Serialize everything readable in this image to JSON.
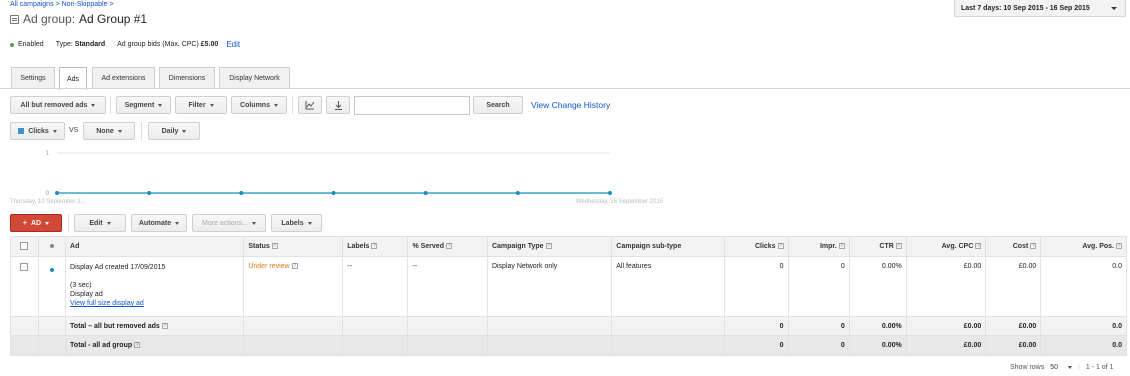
{
  "breadcrumb": {
    "root": "All campaigns",
    "sep": ">",
    "campaign": "Non-Skippable",
    "trail": ">"
  },
  "title": {
    "prefix": "Ad group:",
    "name": "Ad Group #1"
  },
  "date_range": "Last 7 days: 10 Sep 2015 - 16 Sep 2015",
  "status": {
    "state": "Enabled",
    "type_label": "Type:",
    "type_value": "Standard",
    "bids_label": "Ad group bids (Max. CPC)",
    "bids_value": "£5.00",
    "edit": "Edit"
  },
  "tabs": [
    "Settings",
    "Ads",
    "Ad extensions",
    "Dimensions",
    "Display Network"
  ],
  "active_tab": "Ads",
  "toolbar": {
    "filter_view": "All but removed ads",
    "segment": "Segment",
    "filter": "Filter",
    "columns": "Columns",
    "chart_icon": "line-chart-icon",
    "download_icon": "download-icon",
    "search_value": "",
    "search_button": "Search",
    "history_link": "View Change History"
  },
  "chart_controls": {
    "metric1": "Clicks",
    "vs": "VS",
    "metric2": "None",
    "period": "Daily"
  },
  "chart_data": {
    "type": "line",
    "x": [
      "Thursday, 10 September 2...",
      "",
      "",
      "",
      "",
      "",
      "Wednesday, 16 September 2015"
    ],
    "series": [
      {
        "values": [
          0,
          0,
          0,
          0,
          0,
          0,
          0
        ],
        "color": "#1a8fc4"
      }
    ],
    "yticks": [
      "1",
      "0"
    ],
    "ylim": [
      0,
      1
    ],
    "grid": true
  },
  "actions": {
    "add": "AD",
    "edit": "Edit",
    "automate": "Automate",
    "more": "More actions...",
    "labels": "Labels"
  },
  "table": {
    "headers": {
      "ad": "Ad",
      "status": "Status",
      "labels": "Labels",
      "served": "% Served",
      "campaign_type": "Campaign Type",
      "campaign_subtype": "Campaign sub-type",
      "clicks": "Clicks",
      "impr": "Impr.",
      "ctr": "CTR",
      "avg_cpc": "Avg. CPC",
      "cost": "Cost",
      "avg_pos": "Avg. Pos."
    },
    "row": {
      "ad_title": "Display Ad created 17/09/2015",
      "ad_duration": "(3 sec)",
      "ad_kind": "Display ad",
      "ad_link": "View full size display ad",
      "status": "Under review",
      "labels": "--",
      "served": "--",
      "campaign_type": "Display Network only",
      "campaign_subtype": "All features",
      "clicks": "0",
      "impr": "0",
      "ctr": "0.00%",
      "avg_cpc": "£0.00",
      "cost": "£0.00",
      "avg_pos": "0.0"
    },
    "total_but_removed": {
      "label": "Total – all but removed ads",
      "clicks": "0",
      "impr": "0",
      "ctr": "0.00%",
      "avg_cpc": "£0.00",
      "cost": "£0.00",
      "avg_pos": "0.0"
    },
    "total_group": {
      "label": "Total - all ad group",
      "clicks": "0",
      "impr": "0",
      "ctr": "0.00%",
      "avg_cpc": "£0.00",
      "cost": "£0.00",
      "avg_pos": "0.0"
    }
  },
  "footer": {
    "show_rows_label": "Show rows",
    "rows_value": "50",
    "range": "1 - 1 of 1"
  }
}
